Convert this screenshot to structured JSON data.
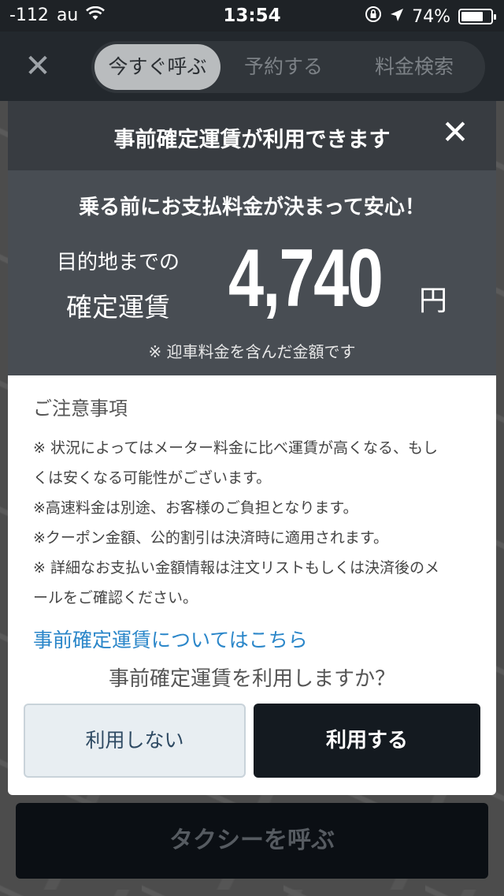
{
  "status_bar": {
    "signal": "-112",
    "carrier": "au",
    "time": "13:54",
    "battery": "74%",
    "battery_level": 0.74
  },
  "nav": {
    "tabs": [
      {
        "label": "今すぐ呼ぶ",
        "active": true
      },
      {
        "label": "予約する",
        "active": false
      },
      {
        "label": "料金検索",
        "active": false
      }
    ]
  },
  "modal": {
    "title": "事前確定運賃が利用できます",
    "headline": "乗る前にお支払料金が決まって安心！",
    "fare_label_line1": "目的地までの",
    "fare_label_line2": "確定運賃",
    "fare_amount": "4,740",
    "fare_unit": "円",
    "fare_note": "※ 迎車料金を含んだ金額です",
    "notes_title": "ご注意事項",
    "notes_lines": [
      "※ 状況によってはメーター料金に比べ運賃が高くなる、もし",
      "くは安くなる可能性がございます。",
      "※高速料金は別途、お客様のご負担となります。",
      "※クーポン金額、公的割引は決済時に適用されます。",
      "※ 詳細なお支払い金額情報は注文リストもしくは決済後のメ",
      "ールをご確認ください。"
    ],
    "link": "事前確定運賃についてはこちら",
    "question": "事前確定運賃を利用しますか？",
    "decline_label": "利用しない",
    "accept_label": "利用する"
  },
  "call_button_label": "タクシーを呼ぶ",
  "colors": {
    "header": "#383c41",
    "fare_panel": "#484d53",
    "link": "#2a86c9",
    "primary_button": "#141a20"
  }
}
